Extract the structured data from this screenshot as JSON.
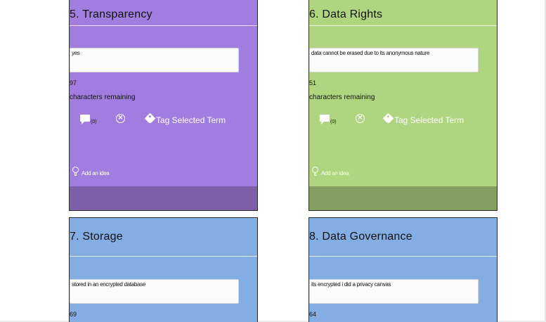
{
  "tools": {
    "tag_label": "Tag Selected Term",
    "idea_label": "Add an idea",
    "remaining_label": "characters remaining"
  },
  "cards": [
    {
      "title": "5. Transparency",
      "answer": "yes",
      "chars_left": "97",
      "comment_count": "(0)",
      "color": "#a27de0",
      "footer_color": "#7d60a8"
    },
    {
      "title": "6. Data Rights",
      "answer": "data cannot be erased due to its anonymous nature",
      "chars_left": "51",
      "comment_count": "(0)",
      "color": "#b0d580",
      "footer_color": "#849f5f"
    },
    {
      "title": "7. Storage",
      "answer": "stored in an encrypted database",
      "chars_left": "69",
      "color": "#84ade4"
    },
    {
      "title": "8. Data Governance",
      "answer": "its encrypted i did a privacy canvas",
      "chars_left": "64",
      "color": "#84ade4"
    }
  ]
}
